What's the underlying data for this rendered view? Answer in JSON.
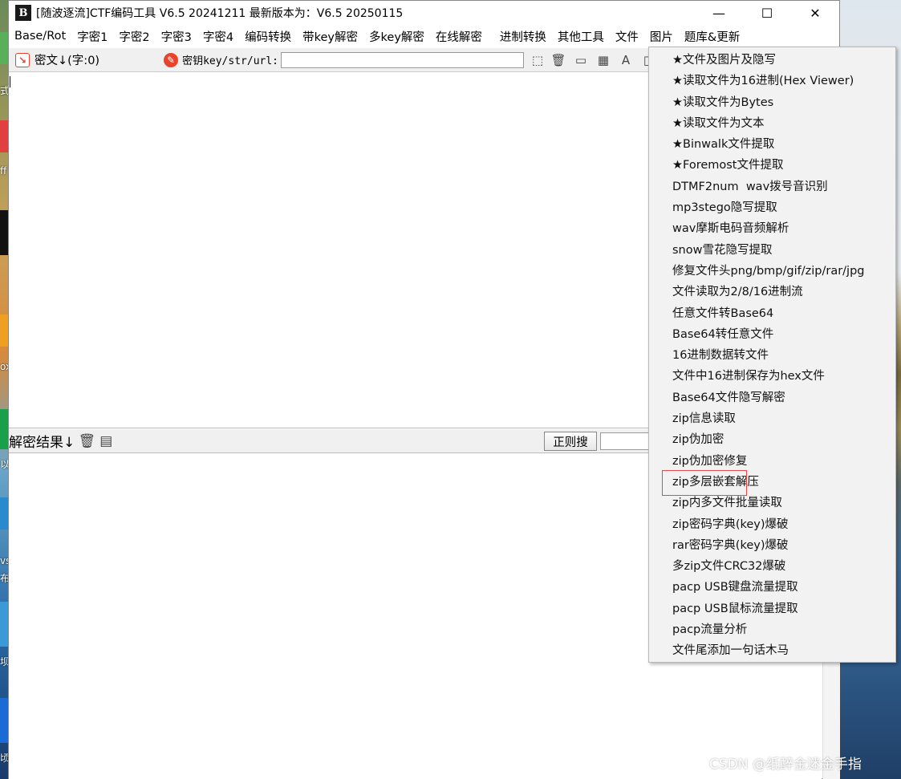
{
  "window": {
    "app_icon_text": "B",
    "title": "[随波逐流]CTF编码工具 V6.5 20241211     最新版本为：V6.5 20250115",
    "controls": {
      "minimize": "—",
      "maximize": "☐",
      "close": "✕"
    }
  },
  "menubar": {
    "items": [
      "Base/Rot",
      "字密1",
      "字密2",
      "字密3",
      "字密4",
      "编码转换",
      "带key解密",
      "多key解密",
      "在线解密",
      "进制转换",
      "其他工具",
      "文件",
      "图片",
      "题库&更新"
    ]
  },
  "toolbar": {
    "cipher_label": "密文↓(字:0)",
    "key_label": "密钥key/str/url:",
    "key_value": ""
  },
  "result": {
    "label": "解密结果↓",
    "regex_button": "正则搜",
    "regex_value": ""
  },
  "file_menu": {
    "items": [
      "★文件及图片及隐写",
      "★读取文件为16进制(Hex Viewer)",
      "★读取文件为Bytes",
      "★读取文件为文本",
      "★Binwalk文件提取",
      "★Foremost文件提取",
      "DTMF2num  wav拨号音识别",
      "mp3stego隐写提取",
      "wav摩斯电码音频解析",
      "snow雪花隐写提取",
      "修复文件头png/bmp/gif/zip/rar/jpg",
      "文件读取为2/8/16进制流",
      "任意文件转Base64",
      "Base64转任意文件",
      "16进制数据转文件",
      "文件中16进制保存为hex文件",
      "Base64文件隐写解密",
      "zip信息读取",
      "zip伪加密",
      "zip伪加密修复",
      "zip多层嵌套解压",
      "zip内多文件批量读取",
      "zip密码字典(key)爆破",
      "rar密码字典(key)爆破",
      "多zip文件CRC32爆破",
      "pacp USB键盘流量提取",
      "pacp USB鼠标流量提取",
      "pacp流量分析",
      "文件尾添加一句话木马"
    ],
    "highlighted": "zip多层嵌套解压"
  },
  "desktop_fragments": [
    "式",
    "ff",
    "ox",
    "以",
    "vs",
    "布",
    "坝",
    "顷"
  ],
  "watermark": "CSDN @纸醉金迷金手指",
  "colors": {
    "highlight_border": "#e34b4b",
    "menu_bg": "#f2f2f2",
    "red_icon": "#e8432d"
  }
}
